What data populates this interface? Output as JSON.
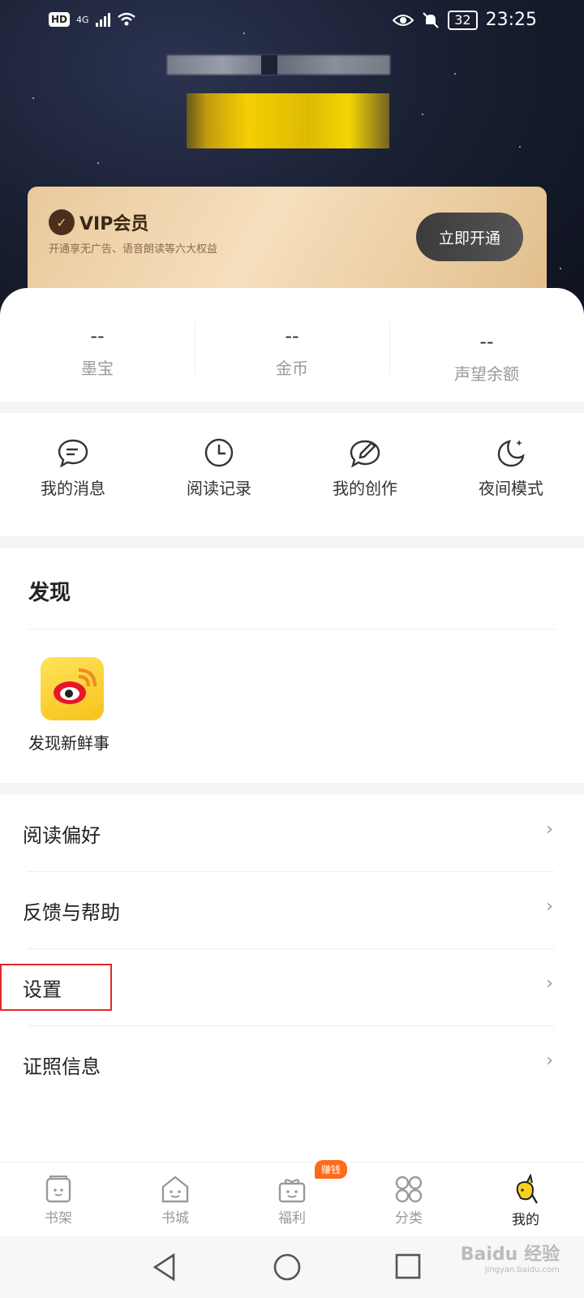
{
  "statusbar": {
    "hd": "HD",
    "network": "4G",
    "battery": "32",
    "time": "23:25"
  },
  "vip": {
    "title": "VIP会员",
    "subtitle": "开通享无广告、语音朗读等六大权益",
    "button": "立即开通"
  },
  "stats": [
    {
      "value": "--",
      "label": "墨宝"
    },
    {
      "value": "--",
      "label": "金币"
    },
    {
      "value": "--",
      "label": "声望余额"
    }
  ],
  "quick": [
    {
      "label": "我的消息",
      "icon": "message-icon"
    },
    {
      "label": "阅读记录",
      "icon": "clock-icon"
    },
    {
      "label": "我的创作",
      "icon": "pen-icon"
    },
    {
      "label": "夜间模式",
      "icon": "moon-icon"
    }
  ],
  "discover": {
    "title": "发现",
    "item_label": "发现新鲜事",
    "item_icon": "weibo-icon"
  },
  "menu": [
    {
      "label": "阅读偏好"
    },
    {
      "label": "反馈与帮助"
    },
    {
      "label": "设置"
    },
    {
      "label": "证照信息"
    }
  ],
  "tabs": [
    {
      "label": "书架",
      "icon": "bookshelf-icon"
    },
    {
      "label": "书城",
      "icon": "bookstore-icon"
    },
    {
      "label": "福利",
      "icon": "gift-icon"
    },
    {
      "label": "分类",
      "icon": "category-icon"
    },
    {
      "label": "我的",
      "icon": "profile-icon"
    }
  ],
  "tab_badge": "赚钱",
  "watermark": {
    "brand": "Baidu 经验",
    "url": "jingyan.baidu.com"
  }
}
